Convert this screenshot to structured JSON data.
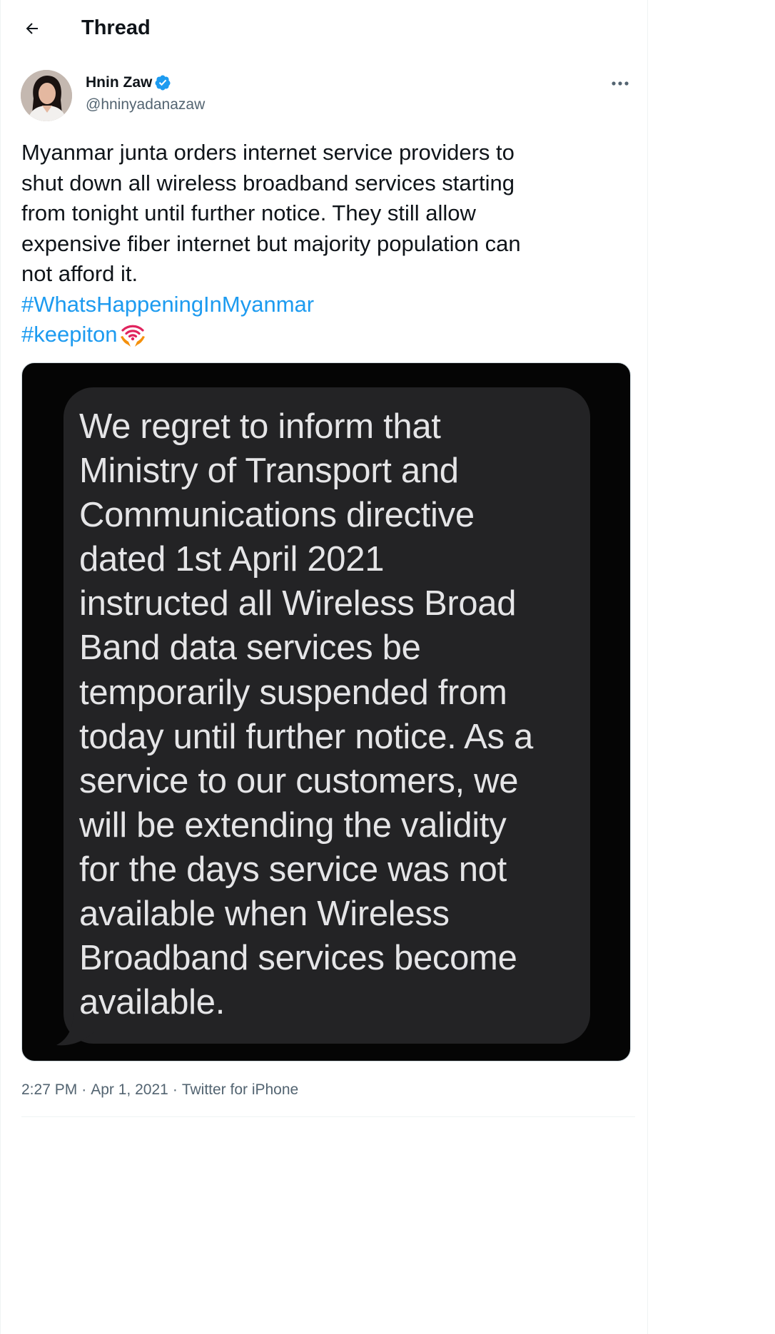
{
  "header": {
    "title": "Thread"
  },
  "author": {
    "name": "Hnin Zaw",
    "handle": "@hninyadanazaw",
    "verified": true
  },
  "tweet": {
    "lines": [
      "Myanmar junta orders internet service providers to",
      "shut down all wireless broadband services starting",
      "from tonight until further notice. They still allow",
      "expensive fiber internet but majority population can",
      "not afford it."
    ],
    "hashtags": [
      "#WhatsHappeningInMyanmar",
      "#keepiton"
    ],
    "hashtag_color": "#1d9bf0"
  },
  "media": {
    "message_lines": [
      "We regret to inform that",
      "Ministry of Transport and",
      "Communications directive",
      "dated 1st April 2021",
      "instructed all Wireless Broad",
      "Band data services be",
      "temporarily suspended from",
      "today until further notice. As a",
      "service to our customers, we",
      "will be extending the validity",
      "for the days service was not",
      "available when Wireless",
      "Broadband services become",
      "available."
    ]
  },
  "meta": {
    "time": "2:27 PM",
    "separator": "·",
    "date": "Apr 1, 2021",
    "source": "Twitter for iPhone"
  }
}
